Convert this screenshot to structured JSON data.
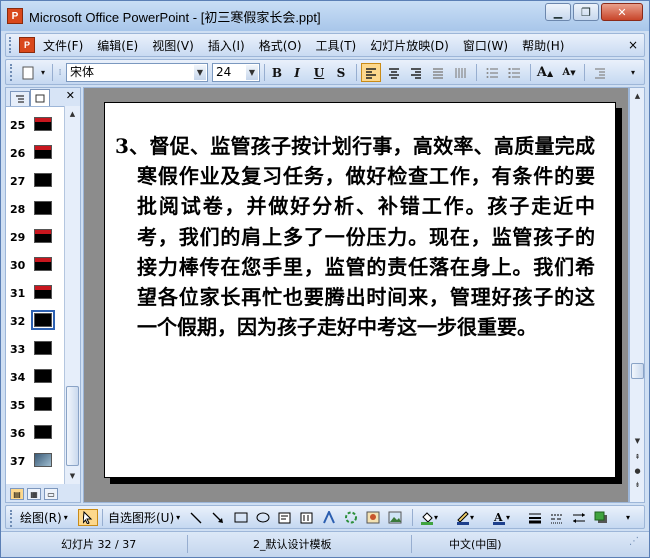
{
  "window": {
    "title": "Microsoft Office PowerPoint - [初三寒假家长会.ppt]"
  },
  "menu": {
    "items": [
      "文件(F)",
      "编辑(E)",
      "视图(V)",
      "插入(I)",
      "格式(O)",
      "工具(T)",
      "幻灯片放映(D)",
      "窗口(W)",
      "帮助(H)"
    ],
    "close_glyph": "×"
  },
  "toolbar": {
    "font": "宋体",
    "font_size": "24",
    "bold": "B",
    "italic": "I",
    "underline": "U",
    "shadow": "S",
    "grow_font": "A",
    "shrink_font": "A"
  },
  "slides_panel": {
    "current": "32",
    "items": [
      {
        "num": "25",
        "style": "red"
      },
      {
        "num": "26",
        "style": "red"
      },
      {
        "num": "27",
        "style": "plain"
      },
      {
        "num": "28",
        "style": "plain"
      },
      {
        "num": "29",
        "style": "red"
      },
      {
        "num": "30",
        "style": "red"
      },
      {
        "num": "31",
        "style": "red"
      },
      {
        "num": "32",
        "style": "selected"
      },
      {
        "num": "33",
        "style": "plain"
      },
      {
        "num": "34",
        "style": "plain"
      },
      {
        "num": "35",
        "style": "plain"
      },
      {
        "num": "36",
        "style": "plain"
      },
      {
        "num": "37",
        "style": "picture"
      }
    ]
  },
  "slide": {
    "text": "3、督促、监管孩子按计划行事，高效率、高质量完成寒假作业及复习任务，做好检查工作，有条件的要批阅试卷，并做好分析、补错工作。孩子走近中考，我们的肩上多了一份压力。现在，监管孩子的接力棒传在您手里，监管的责任落在身上。我们希望各位家长再忙也要腾出时间来，管理好孩子的这一个假期，因为孩子走好中考这一步很重要。"
  },
  "drawing_toolbar": {
    "draw_label": "绘图(R)",
    "autoshapes_label": "自选图形(U)"
  },
  "status": {
    "slide_counter": "幻灯片 32 / 37",
    "template": "2_默认设计模板",
    "language": "中文(中国)"
  },
  "colors": {
    "accent_red": "#c8161e",
    "toolbar_blue": "#c5d8f1",
    "active_orange": "#fdd88c"
  }
}
